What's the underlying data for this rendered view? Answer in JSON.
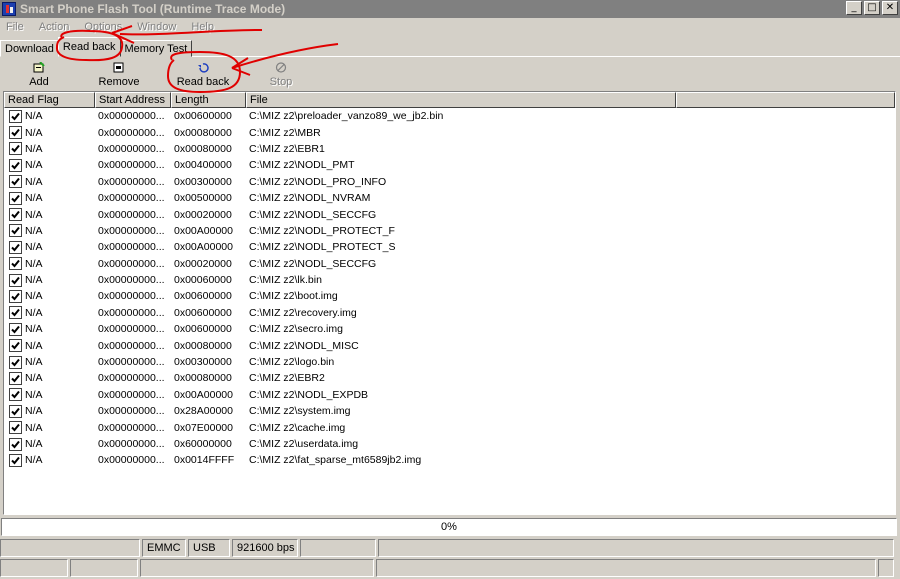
{
  "window": {
    "title": "Smart Phone Flash Tool (Runtime Trace Mode)",
    "min": "_",
    "max": "□",
    "close": "✕"
  },
  "menu": [
    "File",
    "Action",
    "Options",
    "Window",
    "Help"
  ],
  "tabs": [
    "Download",
    "Read back",
    "Memory Test"
  ],
  "toolbar": {
    "add": "Add",
    "remove": "Remove",
    "readback": "Read back",
    "stop": "Stop"
  },
  "columns": [
    "Read Flag",
    "Start Address",
    "Length",
    "File"
  ],
  "rows": [
    {
      "flag": "N/A",
      "addr": "0x00000000...",
      "len": "0x00600000",
      "file": "C:\\MIZ z2\\preloader_vanzo89_we_jb2.bin"
    },
    {
      "flag": "N/A",
      "addr": "0x00000000...",
      "len": "0x00080000",
      "file": "C:\\MIZ z2\\MBR"
    },
    {
      "flag": "N/A",
      "addr": "0x00000000...",
      "len": "0x00080000",
      "file": "C:\\MIZ z2\\EBR1"
    },
    {
      "flag": "N/A",
      "addr": "0x00000000...",
      "len": "0x00400000",
      "file": "C:\\MIZ z2\\NODL_PMT"
    },
    {
      "flag": "N/A",
      "addr": "0x00000000...",
      "len": "0x00300000",
      "file": "C:\\MIZ z2\\NODL_PRO_INFO"
    },
    {
      "flag": "N/A",
      "addr": "0x00000000...",
      "len": "0x00500000",
      "file": "C:\\MIZ z2\\NODL_NVRAM"
    },
    {
      "flag": "N/A",
      "addr": "0x00000000...",
      "len": "0x00020000",
      "file": "C:\\MIZ z2\\NODL_SECCFG"
    },
    {
      "flag": "N/A",
      "addr": "0x00000000...",
      "len": "0x00A00000",
      "file": "C:\\MIZ z2\\NODL_PROTECT_F"
    },
    {
      "flag": "N/A",
      "addr": "0x00000000...",
      "len": "0x00A00000",
      "file": "C:\\MIZ z2\\NODL_PROTECT_S"
    },
    {
      "flag": "N/A",
      "addr": "0x00000000...",
      "len": "0x00020000",
      "file": "C:\\MIZ z2\\NODL_SECCFG"
    },
    {
      "flag": "N/A",
      "addr": "0x00000000...",
      "len": "0x00060000",
      "file": "C:\\MIZ z2\\lk.bin"
    },
    {
      "flag": "N/A",
      "addr": "0x00000000...",
      "len": "0x00600000",
      "file": "C:\\MIZ z2\\boot.img"
    },
    {
      "flag": "N/A",
      "addr": "0x00000000...",
      "len": "0x00600000",
      "file": "C:\\MIZ z2\\recovery.img"
    },
    {
      "flag": "N/A",
      "addr": "0x00000000...",
      "len": "0x00600000",
      "file": "C:\\MIZ z2\\secro.img"
    },
    {
      "flag": "N/A",
      "addr": "0x00000000...",
      "len": "0x00080000",
      "file": "C:\\MIZ z2\\NODL_MISC"
    },
    {
      "flag": "N/A",
      "addr": "0x00000000...",
      "len": "0x00300000",
      "file": "C:\\MIZ z2\\logo.bin"
    },
    {
      "flag": "N/A",
      "addr": "0x00000000...",
      "len": "0x00080000",
      "file": "C:\\MIZ z2\\EBR2"
    },
    {
      "flag": "N/A",
      "addr": "0x00000000...",
      "len": "0x00A00000",
      "file": "C:\\MIZ z2\\NODL_EXPDB"
    },
    {
      "flag": "N/A",
      "addr": "0x00000000...",
      "len": "0x28A00000",
      "file": "C:\\MIZ z2\\system.img"
    },
    {
      "flag": "N/A",
      "addr": "0x00000000...",
      "len": "0x07E00000",
      "file": "C:\\MIZ z2\\cache.img"
    },
    {
      "flag": "N/A",
      "addr": "0x00000000...",
      "len": "0x60000000",
      "file": "C:\\MIZ z2\\userdata.img"
    },
    {
      "flag": "N/A",
      "addr": "0x00000000...",
      "len": "0x0014FFFF",
      "file": "C:\\MIZ z2\\fat_sparse_mt6589jb2.img"
    }
  ],
  "progress": {
    "text": "0%",
    "value": 0
  },
  "status": {
    "storage": "EMMC",
    "port": "USB",
    "baud": "921600 bps"
  },
  "colors": {
    "annotation": "#e00000",
    "chrome": "#d4d0c8",
    "titlebar": "#808080"
  }
}
